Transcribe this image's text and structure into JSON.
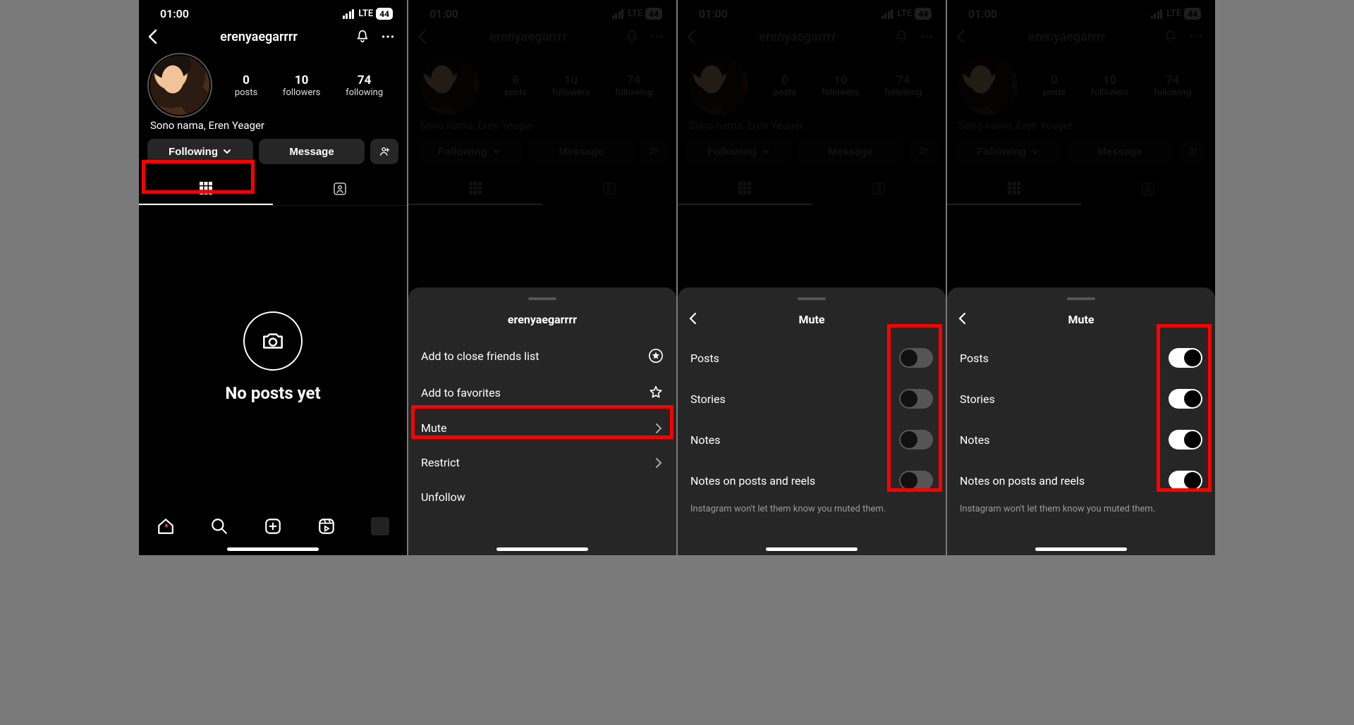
{
  "status": {
    "time": "01:00",
    "network": "LTE",
    "battery": "44"
  },
  "profile": {
    "username": "erenyaegarrrr",
    "bio": "Sono nama, Eren Yeager",
    "posts_count": "0",
    "followers_count": "10",
    "following_count": "74",
    "posts_label": "posts",
    "followers_label": "followers",
    "following_label": "following"
  },
  "actions": {
    "following_label": "Following",
    "message_label": "Message"
  },
  "empty_state": {
    "text": "No posts yet"
  },
  "following_sheet": {
    "title": "erenyaegarrrr",
    "items": [
      {
        "label": "Add to close friends list",
        "icon": "star-circle"
      },
      {
        "label": "Add to favorites",
        "icon": "star-outline"
      },
      {
        "label": "Mute",
        "icon": "chevron"
      },
      {
        "label": "Restrict",
        "icon": "chevron"
      },
      {
        "label": "Unfollow",
        "icon": ""
      }
    ]
  },
  "mute_sheet": {
    "title": "Mute",
    "options": [
      {
        "label": "Posts"
      },
      {
        "label": "Stories"
      },
      {
        "label": "Notes"
      },
      {
        "label": "Notes on posts and reels"
      }
    ],
    "footnote": "Instagram won't let them know you muted them."
  }
}
